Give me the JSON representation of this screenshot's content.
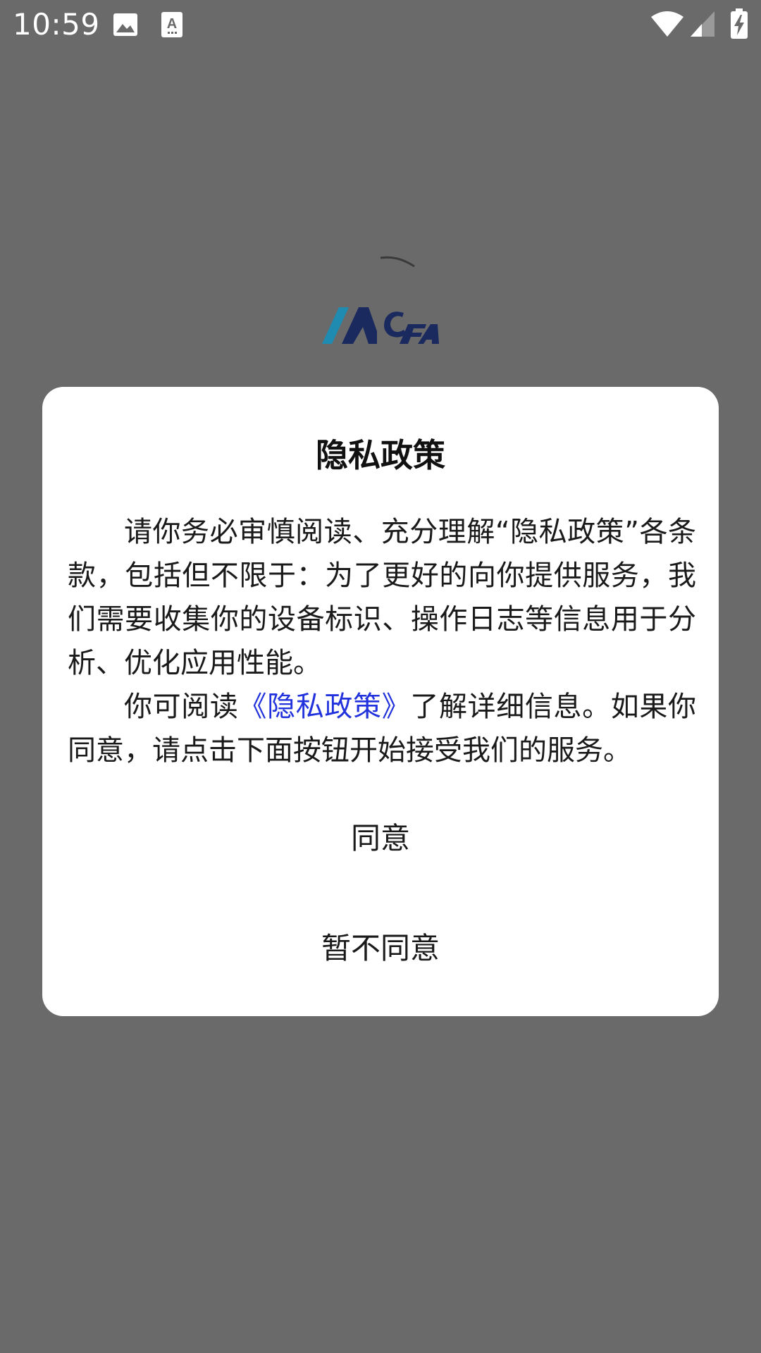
{
  "status_bar": {
    "time": "10:59",
    "left_icons": [
      "image-icon",
      "text-a-icon"
    ],
    "right_icons": [
      "wifi-icon",
      "cellular-signal-icon",
      "battery-charging-icon"
    ]
  },
  "splash": {
    "logo_icon": "acfa-logo-icon",
    "spinner_icon": "loading-arc-icon"
  },
  "dialog": {
    "title": "隐私政策",
    "paragraph1": "请你务必审慎阅读、充分理解“隐私政策”各条款，包括但不限于：为了更好的向你提供服务，我们需要收集你的设备标识、操作日志等信息用于分析、优化应用性能。",
    "paragraph2_prefix": "你可阅读",
    "policy_link": "《隐私政策》",
    "paragraph2_suffix": "了解详细信息。如果你同意，请点击下面按钮开始接受我们的服务。",
    "agree_button": "同意",
    "disagree_button": "暂不同意"
  },
  "colors": {
    "scrim": "#6a6a6a",
    "dialog_bg": "#ffffff",
    "link": "#2233dd",
    "logo_dark": "#1b2a5e",
    "logo_teal": "#1f8bb0"
  }
}
